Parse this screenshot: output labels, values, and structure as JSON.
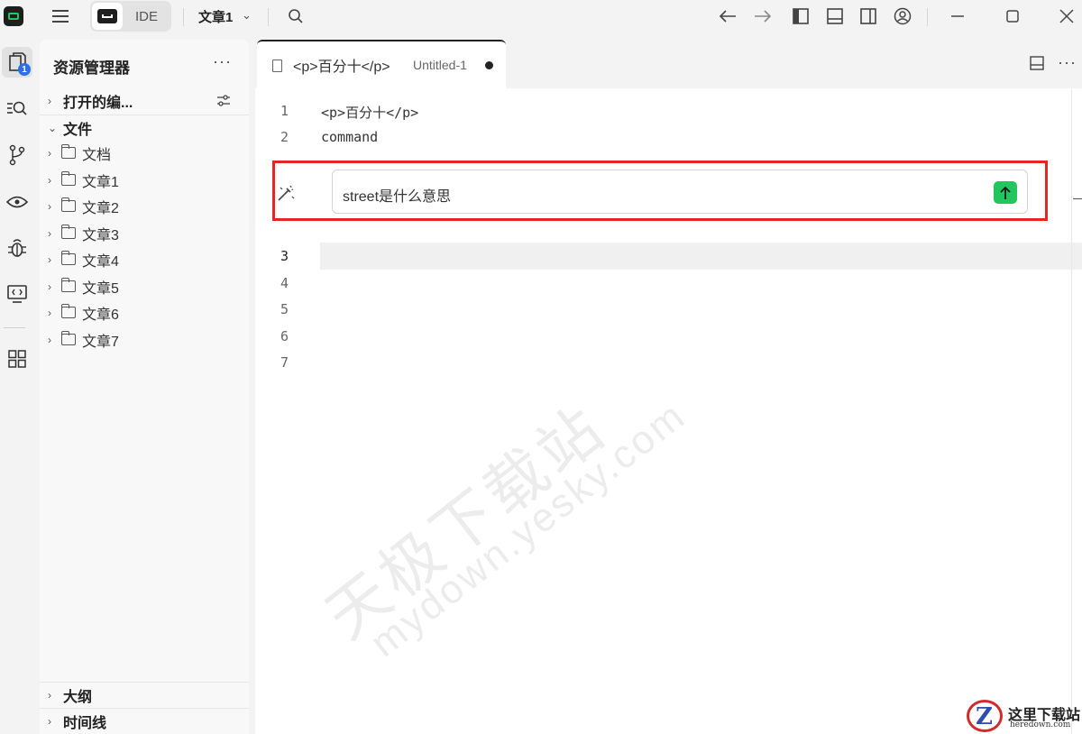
{
  "titlebar": {
    "mode_label": "IDE",
    "project_name": "文章1"
  },
  "activity": {
    "explorer_badge": "1"
  },
  "sidebar": {
    "title": "资源管理器",
    "more": "···",
    "open_editors": "打开的编...",
    "files_section": "文件",
    "folders": [
      {
        "label": "文档"
      },
      {
        "label": "文章1"
      },
      {
        "label": "文章2"
      },
      {
        "label": "文章3"
      },
      {
        "label": "文章4"
      },
      {
        "label": "文章5"
      },
      {
        "label": "文章6"
      },
      {
        "label": "文章7"
      }
    ],
    "outline": "大纲",
    "timeline": "时间线"
  },
  "editor": {
    "tab": {
      "title": "<p>百分十</p>",
      "subtitle": "Untitled-1"
    },
    "tab_more": "···",
    "lines": [
      {
        "no": "1",
        "text": "<p>百分十</p>"
      },
      {
        "no": "2",
        "text": "command"
      },
      {
        "no": "3",
        "text": ""
      },
      {
        "no": "4",
        "text": ""
      },
      {
        "no": "5",
        "text": ""
      },
      {
        "no": "6",
        "text": ""
      },
      {
        "no": "7",
        "text": ""
      }
    ],
    "ai_prompt": {
      "value": "street是什么意思"
    }
  },
  "watermark": {
    "line1": "天极下载站",
    "line2": "mydown.yesky.com"
  },
  "corner_logo": {
    "letter": "Z",
    "name": "这里下载站",
    "domain": "heredown.com"
  },
  "colors": {
    "accent_green": "#22c55e",
    "badge_blue": "#2f6fe4",
    "highlight_red": "#e32626"
  }
}
